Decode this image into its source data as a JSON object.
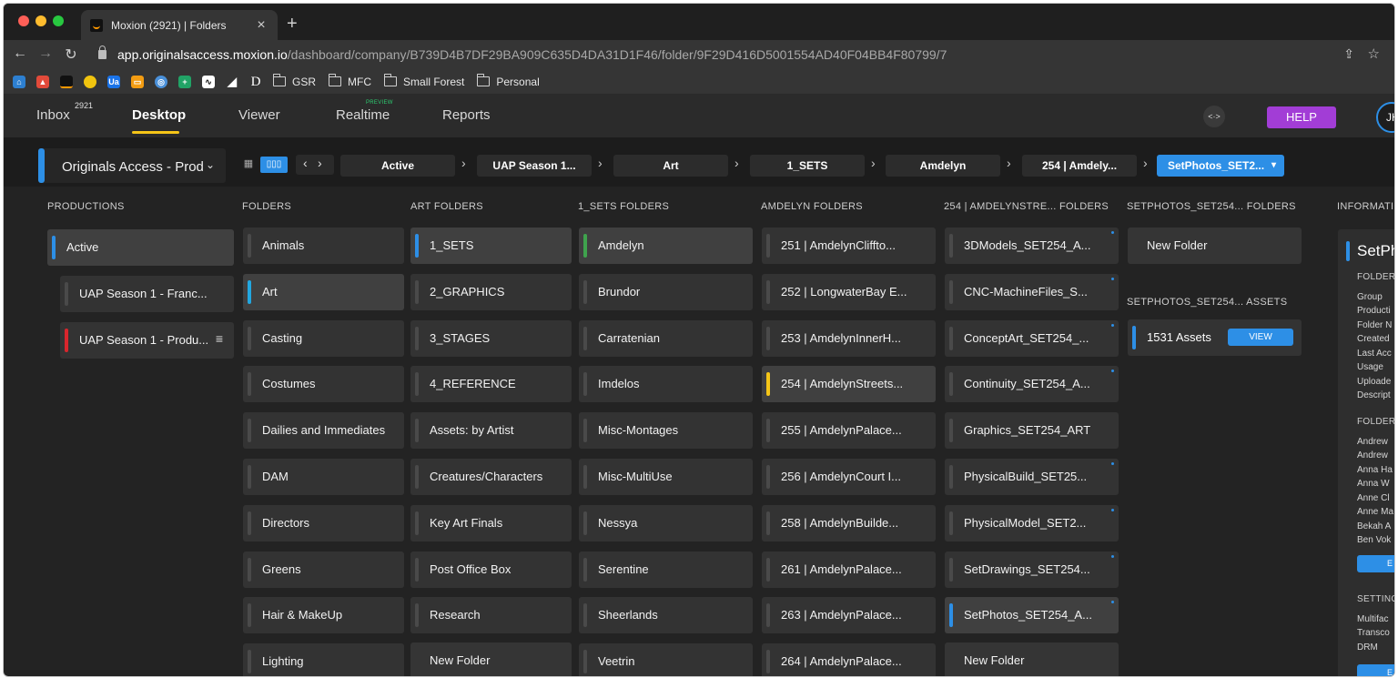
{
  "browser": {
    "tab_title": "Moxion (2921) | Folders",
    "new_tab": "+",
    "close": "×",
    "url_host": "app.originalsaccess.moxion.io",
    "url_path": "/dashboard/company/B739D4B7DF29BA909C635D4DA31D1F46/folder/9F29D416D5001554AD40F04BB4F80799/7",
    "bookmark_folders": [
      "GSR",
      "MFC",
      "Small Forest",
      "Personal"
    ]
  },
  "nav": {
    "inbox": "Inbox",
    "inbox_count": "2921",
    "desktop": "Desktop",
    "viewer": "Viewer",
    "realtime": "Realtime",
    "realtime_badge": "PREVIEW",
    "reports": "Reports",
    "code_btn": "<·>",
    "help": "HELP",
    "avatar": "JH"
  },
  "breadcrumb": {
    "org": "Originals Access - Prod",
    "crumbs": [
      "Active",
      "UAP Season 1...",
      "Art",
      "1_SETS",
      "Amdelyn",
      "254 | Amdely..."
    ],
    "selected": "SetPhotos_SET2..."
  },
  "columns": {
    "productions": {
      "header": "PRODUCTIONS",
      "items": [
        "Active",
        "UAP Season 1 - Franc...",
        "UAP Season 1 - Produ..."
      ]
    },
    "folders": {
      "header": "FOLDERS",
      "items": [
        "Animals",
        "Art",
        "Casting",
        "Costumes",
        "Dailies and Immediates",
        "DAM",
        "Directors",
        "Greens",
        "Hair & MakeUp",
        "Lighting"
      ]
    },
    "art_folders": {
      "header": "ART FOLDERS",
      "items": [
        "1_SETS",
        "2_GRAPHICS",
        "3_STAGES",
        "4_REFERENCE",
        "Assets: by Artist",
        "Creatures/Characters",
        "Key Art Finals",
        "Post Office Box",
        "Research"
      ],
      "new_folder": "New Folder"
    },
    "sets_folders": {
      "header": "1_SETS FOLDERS",
      "items": [
        "Amdelyn",
        "Brundor",
        "Carratenian",
        "Imdelos",
        "Misc-Montages",
        "Misc-MultiUse",
        "Nessya",
        "Serentine",
        "Sheerlands",
        "Veetrin"
      ]
    },
    "amdelyn_folders": {
      "header": "AMDELYN FOLDERS",
      "items": [
        "251 | AmdelynCliffto...",
        "252 | LongwaterBay E...",
        "253 | AmdelynInnerH...",
        "254 | AmdelynStreets...",
        "255 | AmdelynPalace...",
        "256 | AmdelynCourt I...",
        "258 | AmdelynBuilde...",
        "261 | AmdelynPalace...",
        "263 | AmdelynPalace...",
        "264 | AmdelynPalace..."
      ]
    },
    "set254_folders": {
      "header": "254 | AMDELYNSTRE... FOLDERS",
      "items": [
        "3DModels_SET254_A...",
        "CNC-MachineFiles_S...",
        "ConceptArt_SET254_...",
        "Continuity_SET254_A...",
        "Graphics_SET254_ART",
        "PhysicalBuild_SET25...",
        "PhysicalModel_SET2...",
        "SetDrawings_SET254...",
        "SetPhotos_SET254_A..."
      ],
      "new_folder": "New Folder"
    },
    "setphotos_folders": {
      "header": "SETPHOTOS_SET254... FOLDERS",
      "new_folder": "New Folder",
      "assets_header": "SETPHOTOS_SET254... ASSETS",
      "assets_count": "1531 Assets",
      "view": "VIEW"
    }
  },
  "info": {
    "header": "INFORMATIC",
    "title": "SetPh",
    "folder_section": "FOLDER",
    "folder_fields": [
      "Group",
      "Producti",
      "Folder N",
      "Created",
      "Last Acc",
      "Usage",
      "Uploade",
      "Descript"
    ],
    "folder2_section": "FOLDER",
    "users": [
      "Andrew",
      "Andrew",
      "Anna Ha",
      "Anna W",
      "Anne Cl",
      "Anne Ma",
      "Bekah A",
      "Ben Vok"
    ],
    "edit_btn": "E",
    "settings_section": "SETTING",
    "settings": [
      "Multifac",
      "Transco",
      "DRM"
    ],
    "edit_btn2": "E"
  },
  "colors": {
    "accent_blue": "#2d8fe6",
    "green": "#3fa34d",
    "red": "#d8262c",
    "yellow": "#f5c518",
    "cyan": "#22a7e0",
    "help_purple": "#a23dd6"
  }
}
